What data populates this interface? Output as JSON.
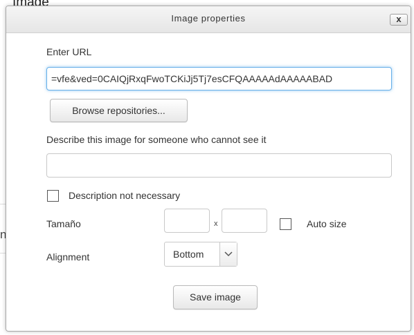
{
  "dialog": {
    "title": "Image properties",
    "close_label": "x"
  },
  "url": {
    "label": "Enter URL",
    "value": "=vfe&ved=0CAIQjRxqFwoTCKiJj5Tj7esCFQAAAAAdAAAAABAD"
  },
  "browse_button": "Browse repositories...",
  "description": {
    "label": "Describe this image for someone who cannot see it",
    "value": "",
    "not_necessary_label": "Description not necessary",
    "not_necessary_checked": false
  },
  "size": {
    "label": "Tamaño",
    "width_value": "",
    "separator": "x",
    "height_value": "",
    "auto_size_label": "Auto size",
    "auto_size_checked": false
  },
  "alignment": {
    "label": "Alignment",
    "selected": "Bottom"
  },
  "save_button": "Save image",
  "background": {
    "top_fragment": "Image",
    "side_letter": "n"
  },
  "colors": {
    "focus_border": "#66afe9",
    "titlebar": "#eeeeee"
  }
}
